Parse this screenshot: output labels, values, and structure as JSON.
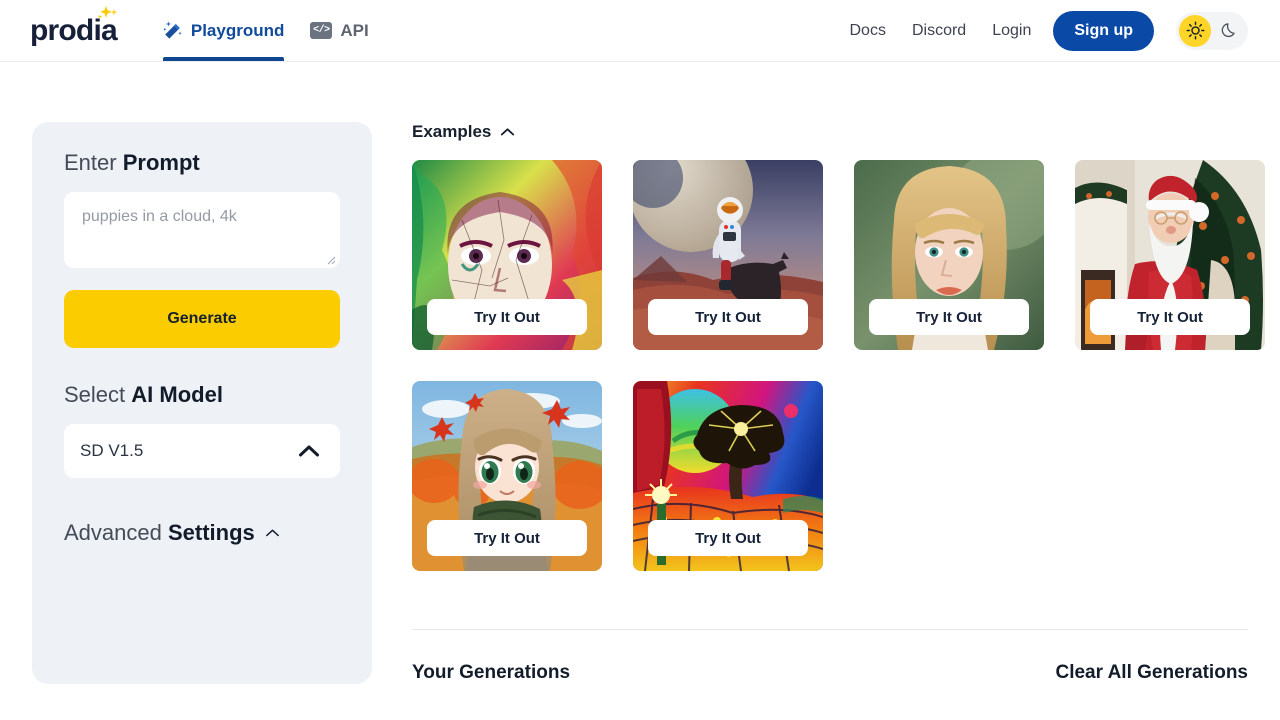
{
  "header": {
    "logo_text": "prodia",
    "tabs": [
      {
        "label": "Playground",
        "icon": "magic-wand-icon",
        "active": true
      },
      {
        "label": "API",
        "icon": "code-brackets-icon",
        "active": false
      }
    ],
    "links": [
      {
        "label": "Docs"
      },
      {
        "label": "Discord"
      },
      {
        "label": "Login"
      }
    ],
    "signup_label": "Sign up",
    "theme": {
      "light_icon": "sun-icon",
      "dark_icon": "moon-icon",
      "active": "light"
    }
  },
  "sidebar": {
    "prompt_label_light": "Enter ",
    "prompt_label_bold": "Prompt",
    "prompt_value": "",
    "prompt_placeholder": "puppies in a cloud, 4k",
    "generate_label": "Generate",
    "model_label_light": "Select ",
    "model_label_bold": "AI Model",
    "model_selected": "SD V1.5",
    "model_chevron": "chevron-up-icon",
    "advanced_label_light": "Advanced ",
    "advanced_label_bold": "Settings",
    "advanced_chevron": "chevron-up-icon"
  },
  "main": {
    "examples_label": "Examples",
    "examples_chevron": "chevron-up-icon",
    "try_label": "Try It Out",
    "examples": [
      {
        "alt": "colorful-painted-woman-portrait",
        "try_label": "Try It Out"
      },
      {
        "alt": "astronaut-riding-horse-on-planet",
        "try_label": "Try It Out"
      },
      {
        "alt": "blonde-woman-photo-portrait",
        "try_label": "Try It Out"
      },
      {
        "alt": "santa-claus-by-christmas-tree",
        "try_label": "Try It Out"
      },
      {
        "alt": "anime-girl-autumn-leaves",
        "try_label": "Try It Out"
      },
      {
        "alt": "psychedelic-tree-landscape",
        "try_label": "Try It Out"
      }
    ],
    "generations_title": "Your Generations",
    "clear_label": "Clear All Generations"
  },
  "colors": {
    "brand_navy": "#0b49a6",
    "accent_yellow": "#fbcc00",
    "sidebar_bg": "#eef1f6",
    "tab_active": "#10458f",
    "text_dark": "#131c2b"
  }
}
